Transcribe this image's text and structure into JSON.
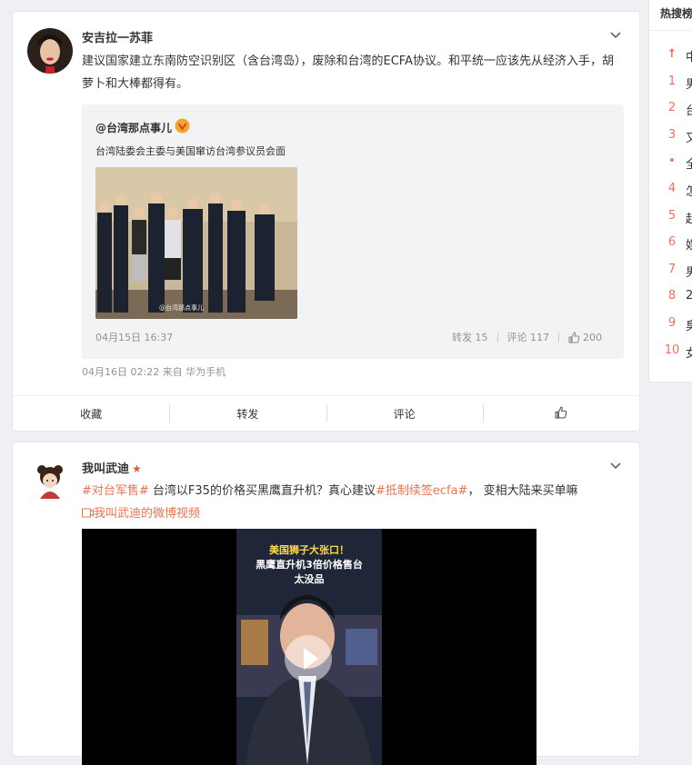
{
  "post1": {
    "username": "安吉拉一苏菲",
    "text": "建议国家建立东南防空识别区（含台湾岛），废除和台湾的ECFA协议。和平统一应该先从经济入手，胡萝卜和大棒都得有。",
    "repost": {
      "user": "@台湾那点事儿",
      "text": "台湾陆委会主委与美国窜访台湾参议员会面",
      "time": "04月15日 16:37",
      "forward": "转发 15",
      "comment": "评论 117",
      "likes": "200"
    },
    "meta": "04月16日 02:22  来自 华为手机",
    "actions": {
      "fav": "收藏",
      "forward": "转发",
      "comment": "评论"
    }
  },
  "post2": {
    "username": "我叫武迪",
    "hashtag1": "#对台军售#",
    "text_mid": " 台湾以F35的价格买黑鹰直升机？真心建议",
    "hashtag2": "#抵制续签ecfa#",
    "text_end": "， 变相大陆来买单嘛",
    "video_link": "我叫武迪的微博视频",
    "video_caption_1": "美国狮子大张口！",
    "video_caption_2": "黑鹰直升机3倍价格售台",
    "video_caption_3": "太没品"
  },
  "sidebar": {
    "title": "热搜榜",
    "items": [
      {
        "rank": "↑",
        "text": "中"
      },
      {
        "rank": "1",
        "text": "男"
      },
      {
        "rank": "2",
        "text": "台"
      },
      {
        "rank": "3",
        "text": "又"
      },
      {
        "rank": "•",
        "text": "全"
      },
      {
        "rank": "4",
        "text": "怎"
      },
      {
        "rank": "5",
        "text": "起"
      },
      {
        "rank": "6",
        "text": "娱"
      },
      {
        "rank": "7",
        "text": "男"
      },
      {
        "rank": "8",
        "text": "2"
      },
      {
        "rank": "9",
        "text": "臭"
      },
      {
        "rank": "10",
        "text": "女"
      }
    ]
  },
  "colors": {
    "accent": "#eb7350",
    "rank": "#f26d5f"
  },
  "icons": [
    "chevron-down-icon",
    "verified-badge-icon",
    "like-icon",
    "play-icon",
    "video-icon",
    "star-icon"
  ]
}
